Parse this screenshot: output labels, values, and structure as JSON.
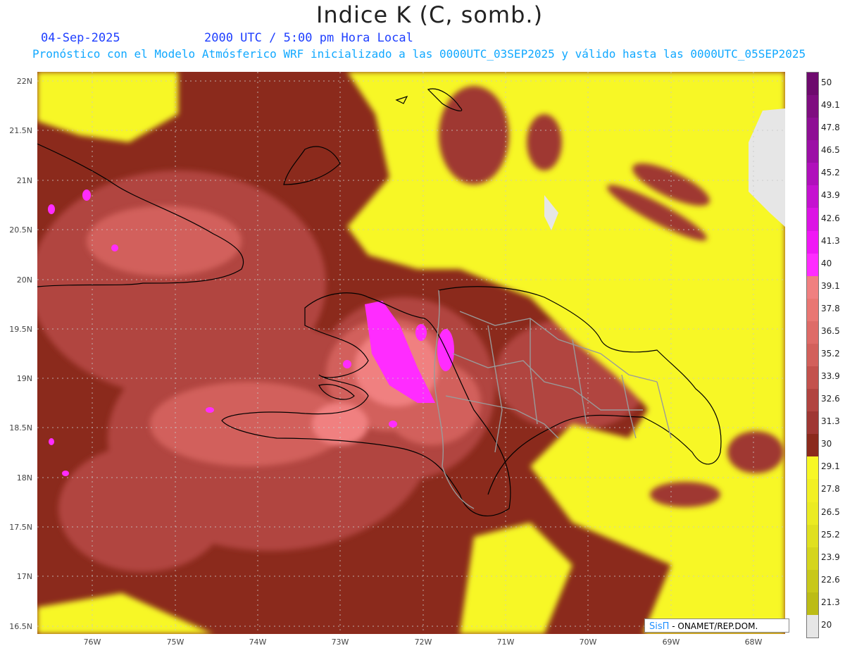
{
  "title": "Indice K (C, somb.)",
  "date_label": "04-Sep-2025",
  "time_label": "2000 UTC / 5:00 pm Hora Local",
  "forecast_label": "Pronóstico con el Modelo Atmósferico WRF inicializado a las 0000UTC_03SEP2025 y válido hasta las  0000UTC_05SEP2025",
  "lat_labels": [
    "22N",
    "21.5N",
    "21N",
    "20.5N",
    "20N",
    "19.5N",
    "19N",
    "18.5N",
    "18N",
    "17.5N",
    "17N",
    "16.5N"
  ],
  "lon_labels": [
    "76W",
    "75W",
    "74W",
    "73W",
    "72W",
    "71W",
    "70W",
    "69W",
    "68W"
  ],
  "colorbar": {
    "labels": [
      "50",
      "49.1",
      "47.8",
      "46.5",
      "45.2",
      "43.9",
      "42.6",
      "41.3",
      "40",
      "39.1",
      "37.8",
      "36.5",
      "35.2",
      "33.9",
      "32.6",
      "31.3",
      "30",
      "29.1",
      "27.8",
      "26.5",
      "25.2",
      "23.9",
      "22.6",
      "21.3",
      "20"
    ],
    "colors": [
      "#6e0a6e",
      "#7f0d80",
      "#8e0e94",
      "#9c0fa6",
      "#b010bb",
      "#c512d0",
      "#dc14e4",
      "#f018f5",
      "#ff2cff",
      "#f08080",
      "#e97773",
      "#de6b67",
      "#d2605b",
      "#c3524d",
      "#b14440",
      "#9f3733",
      "#8b2a1c",
      "#f7f725",
      "#f2f024",
      "#ebeb22",
      "#e0e01f",
      "#d5d51c",
      "#c8c81a",
      "#bcbc16",
      "#e6e6e6"
    ]
  },
  "credit": {
    "brand": "SisΠ",
    "text": " - ONAMET/REP.DOM."
  }
}
